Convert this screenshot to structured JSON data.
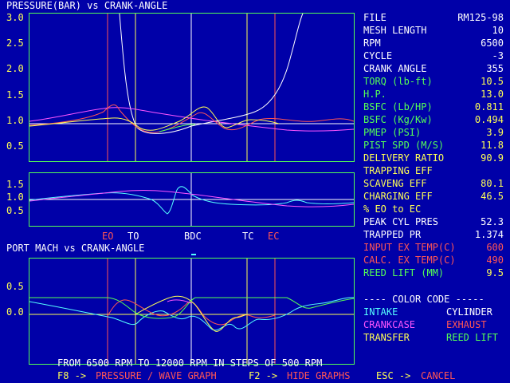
{
  "pressure_graph": {
    "title": "PRESSURE(BAR) vs CRANK-ANGLE",
    "y_ticks": [
      "3.0",
      "2.5",
      "2.0",
      "1.5",
      "1.0",
      "0.5"
    ],
    "lower_y_ticks": [
      "1.5",
      "1.0",
      "0.5"
    ]
  },
  "markers": {
    "eo": "EO",
    "to": "TO",
    "bdc": "BDC",
    "tc": "TC",
    "ec": "EC"
  },
  "mach_graph": {
    "title": "PORT MACH vs CRANK-ANGLE",
    "y_ticks": [
      "0.5",
      "0.0"
    ]
  },
  "readout": {
    "file": {
      "label": "FILE",
      "value": "RM125-98"
    },
    "mesh_length": {
      "label": "MESH LENGTH",
      "value": "10"
    },
    "rpm": {
      "label": "RPM",
      "value": "6500"
    },
    "cycle": {
      "label": "CYCLE",
      "value": "-3"
    },
    "crank_angle": {
      "label": "CRANK ANGLE",
      "value": "355"
    },
    "torq": {
      "label": "TORQ (lb-ft)",
      "value": "10.5"
    },
    "hp": {
      "label": "H.P.",
      "value": "13.0"
    },
    "bsfc_lb": {
      "label": "BSFC (Lb/HP)",
      "value": "0.811"
    },
    "bsfc_kg": {
      "label": "BSFC (Kg/Kw)",
      "value": "0.494"
    },
    "pmep": {
      "label": "PMEP (PSI)",
      "value": "3.9"
    },
    "pist_spd": {
      "label": "PIST SPD (M/S)",
      "value": "11.8"
    },
    "delivery_ratio": {
      "label": "DELIVERY RATIO",
      "value": "90.9"
    },
    "trapping_eff": {
      "label": "TRAPPING EFF",
      "value": ""
    },
    "scaveng_eff": {
      "label": "SCAVENG  EFF",
      "value": "80.1"
    },
    "charging_eff": {
      "label": "CHARGING EFF",
      "value": "46.5"
    },
    "eo_to_ec": {
      "label": "% EO to EC",
      "value": ""
    },
    "peak_cyl_pres": {
      "label": "PEAK CYL PRES",
      "value": "52.3"
    },
    "trapped_pr": {
      "label": "TRAPPED PR",
      "value": "1.374"
    },
    "input_ex_temp": {
      "label": "INPUT EX TEMP(C)",
      "value": "600"
    },
    "calc_ex_temp": {
      "label": "CALC. EX TEMP(C)",
      "value": "490"
    },
    "reed_lift": {
      "label": "REED LIFT (MM)",
      "value": "9.5"
    }
  },
  "color_code": {
    "title": "---- COLOR CODE -----",
    "intake": "INTAKE",
    "cylinder": "CYLINDER",
    "crankcase": "CRANKCASE",
    "exhaust": "EXHAUST",
    "transfer": "TRANSFER",
    "reed_lift": "REED LIFT"
  },
  "footer": {
    "sweep": "FROM 6500 RPM TO 12000 RPM IN STEPS OF 500 RPM",
    "f8_key": "F8 ->",
    "f8_action": "PRESSURE / WAVE GRAPH",
    "f2_key": "F2 ->",
    "f2_action": "HIDE GRAPHS",
    "esc_key": "ESC ->",
    "esc_action": "CANCEL"
  },
  "colors": {
    "background": "#0000a8",
    "grid_frame": "#55ff55",
    "intake": "#55ffff",
    "cylinder": "#ffffff",
    "crankcase": "#ff55ff",
    "exhaust": "#ff5555",
    "transfer": "#ffff55",
    "reed_lift": "#55ff55"
  }
}
